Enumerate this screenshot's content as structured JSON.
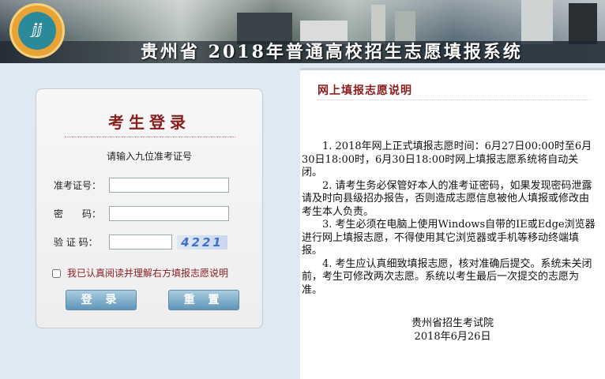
{
  "header": {
    "title": "贵州省 2018年普通高校招生志愿填报系统"
  },
  "login": {
    "title": "考生登录",
    "hint": "请输入九位准考证号",
    "ticket_label": "准考证号：",
    "ticket_value": "",
    "password_label": "密　　码：",
    "password_value": "",
    "captcha_label": "验 证 码：",
    "captcha_value": "",
    "captcha_code": "4221",
    "agree_label": "我已认真阅读并理解右方填报志愿说明",
    "login_button": "登 录",
    "reset_button": "重 置"
  },
  "notice": {
    "title": "网上填报志愿说明",
    "items": [
      "1. 2018年网上正式填报志愿时间：6月27日00:00时至6月30日18:00时，6月30日18:00时网上填报志愿系统将自动关闭。",
      "2. 请考生务必保管好本人的准考证密码，如果发现密码泄露请及时向县级招办报告，否则造成志愿信息被他人填报或修改由考生本人负责。",
      "3. 考生必须在电脑上使用Windows自带的IE或Edge浏览器进行网上填报志愿，不得使用其它浏览器或手机等移动终端填报。",
      "4. 考生应认真细致填报志愿，核对准确后提交。系统未关闭前，考生可修改两次志愿。系统以考生最后一次提交的志愿为准。"
    ],
    "signature": "贵州省招生考试院",
    "date": "2018年6月26日"
  },
  "colors": {
    "accent": "#8a1c1c",
    "page_bg": "#dfe9f3",
    "button": "#5f95b8"
  }
}
